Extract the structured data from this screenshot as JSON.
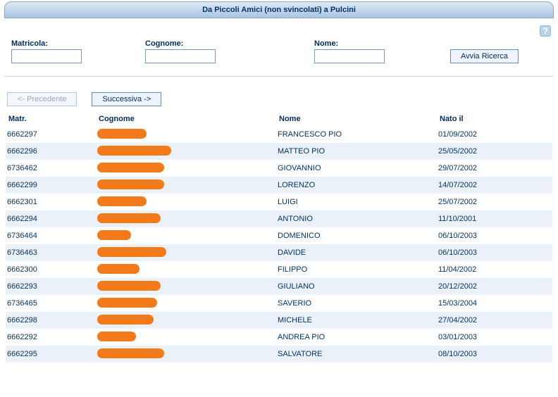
{
  "header": {
    "title": "Da Piccoli Amici (non svincolati) a Pulcini"
  },
  "help": {
    "glyph": "?"
  },
  "search": {
    "matricola": {
      "label": "Matricola:",
      "value": ""
    },
    "cognome": {
      "label": "Cognome:",
      "value": ""
    },
    "nome": {
      "label": "Nome:",
      "value": ""
    },
    "submit_label": "Avvia Ricerca"
  },
  "pager": {
    "prev_label": "<- Precedente",
    "next_label": "Successiva ->"
  },
  "table": {
    "headers": {
      "matr": "Matr.",
      "cognome": "Cognome",
      "nome": "Nome",
      "nato": "Nato il"
    },
    "rows": [
      {
        "matr": "6662297",
        "cognome_w": 70,
        "nome": "FRANCESCO PIO",
        "nato": "01/09/2002"
      },
      {
        "matr": "6662296",
        "cognome_w": 105,
        "nome": "MATTEO PIO",
        "nato": "25/05/2002"
      },
      {
        "matr": "6736462",
        "cognome_w": 95,
        "nome": "GIOVANNIO",
        "nato": "29/07/2002"
      },
      {
        "matr": "6662299",
        "cognome_w": 95,
        "nome": "LORENZO",
        "nato": "14/07/2002"
      },
      {
        "matr": "6662301",
        "cognome_w": 70,
        "nome": "LUIGI",
        "nato": "25/07/2002"
      },
      {
        "matr": "6662294",
        "cognome_w": 90,
        "nome": "ANTONIO",
        "nato": "11/10/2001"
      },
      {
        "matr": "6736464",
        "cognome_w": 48,
        "nome": "DOMENICO",
        "nato": "06/10/2003"
      },
      {
        "matr": "6736463",
        "cognome_w": 98,
        "nome": "DAVIDE",
        "nato": "06/10/2003"
      },
      {
        "matr": "6662300",
        "cognome_w": 60,
        "nome": "FILIPPO",
        "nato": "11/04/2002"
      },
      {
        "matr": "6662293",
        "cognome_w": 90,
        "nome": "GIULIANO",
        "nato": "20/12/2002"
      },
      {
        "matr": "6736465",
        "cognome_w": 85,
        "nome": "SAVERIO",
        "nato": "15/03/2004"
      },
      {
        "matr": "6662298",
        "cognome_w": 80,
        "nome": "MICHELE",
        "nato": "27/04/2002"
      },
      {
        "matr": "6662292",
        "cognome_w": 55,
        "nome": "ANDREA PIO",
        "nato": "03/01/2003"
      },
      {
        "matr": "6662295",
        "cognome_w": 95,
        "nome": "SALVATORE",
        "nato": "08/10/2003"
      }
    ]
  }
}
